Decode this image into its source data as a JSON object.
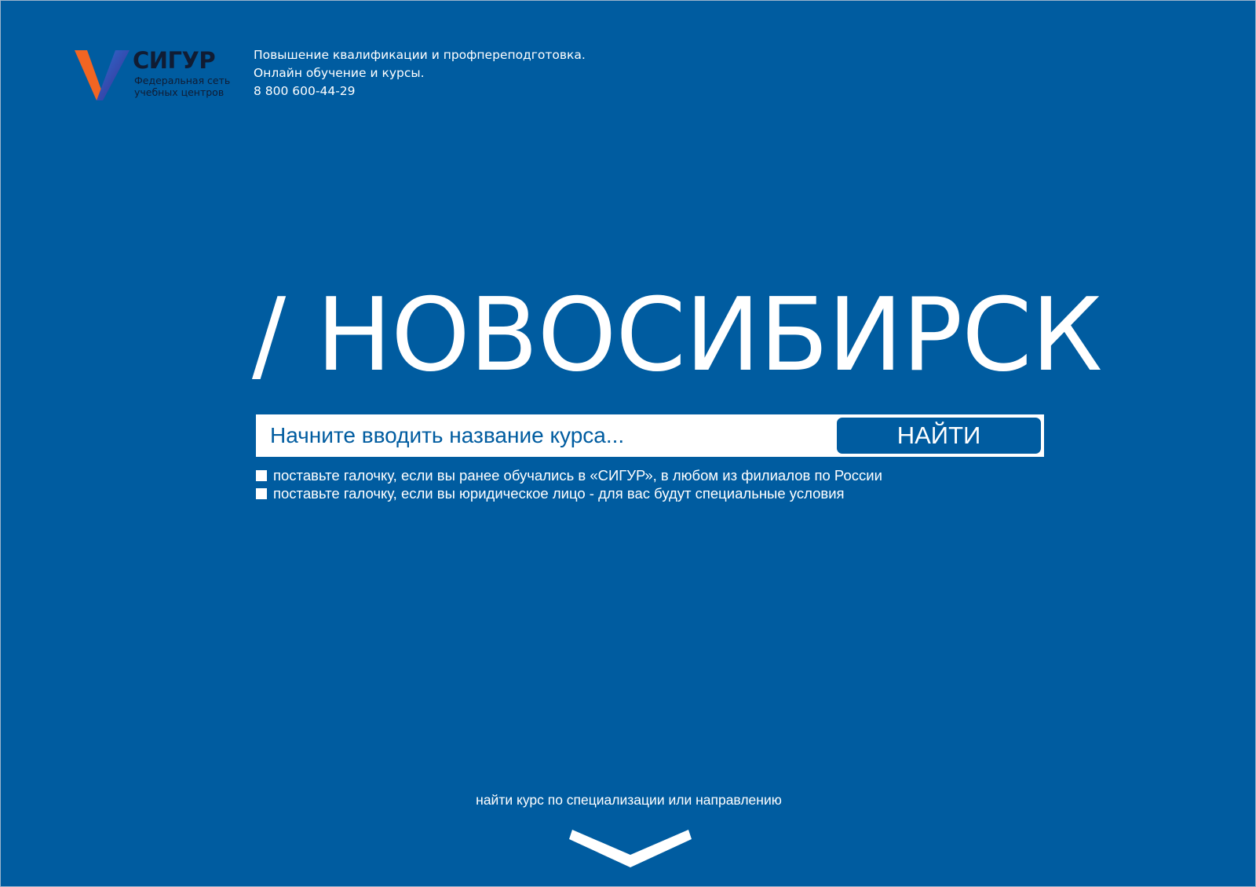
{
  "header": {
    "logo_text": "СИГУР",
    "logo_subtitle_line1": "Федеральная сеть",
    "logo_subtitle_line2": "учебных центров",
    "info_line1": "Повышение квалификации и профпереподготовка.",
    "info_line2": "Онлайн обучение и курсы.",
    "phone": "8 800 600-44-29"
  },
  "hero": {
    "city_title": "/ НОВОСИБИРСК"
  },
  "search": {
    "placeholder": "Начните вводить название курса...",
    "value": "",
    "button_label": "НАЙТИ"
  },
  "options": [
    {
      "label": "поставьте галочку, если вы ранее обучались в «СИГУР», в любом из филиалов по России",
      "checked": false
    },
    {
      "label": "поставьте галочку, если вы юридическое лицо - для вас будут специальные условия",
      "checked": false
    }
  ],
  "footer": {
    "browse_link": "найти курс по специализации или направлению",
    "scroll_icon": "chevron-down-icon"
  },
  "colors": {
    "background": "#005ca0",
    "accent_orange": "#f26522",
    "logo_blue": "#1e4fa8",
    "text_light": "#ffffff"
  }
}
